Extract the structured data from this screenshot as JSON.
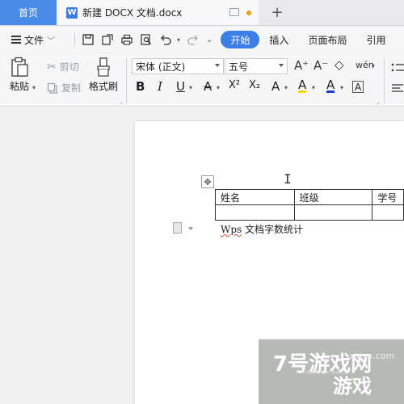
{
  "tabs": {
    "home_label": "首页",
    "doc_title": "新建 DOCX 文档.docx",
    "new_tab": "+"
  },
  "menu": {
    "file_label": "文件",
    "ribbon_tabs": [
      "开始",
      "插入",
      "页面布局",
      "引用"
    ]
  },
  "toolbar": {
    "paste": "粘贴",
    "cut": "剪切",
    "copy": "复制",
    "format_painter": "格式刷",
    "font_name": "宋体 (正文)",
    "font_size": "五号",
    "bold": "B",
    "italic": "I",
    "underline": "U",
    "strike": "A",
    "superscript": "X²",
    "subscript": "X₂",
    "text_effect": "A",
    "highlight": "A",
    "font_color": "A",
    "char_border": "A",
    "grow_font": "A⁺",
    "shrink_font": "A⁻",
    "clear_format": "◇",
    "pinyin": "wén"
  },
  "document": {
    "table": {
      "rows": [
        [
          "姓名",
          "班级",
          "学号"
        ],
        [
          "",
          "",
          ""
        ]
      ]
    },
    "paragraph_underlined": "Wps",
    "paragraph_rest": " 文档字数统计"
  },
  "watermark": {
    "brand": "7号游戏网",
    "pinyin": "7HAOYOUXIWANG",
    "url": "xiayx.com",
    "sub": "游戏"
  },
  "colors": {
    "accent": "#3a7ee6",
    "home_tab": "#4a8be9",
    "highlight": "#f5d800",
    "font_color": "#1a3fd6"
  }
}
